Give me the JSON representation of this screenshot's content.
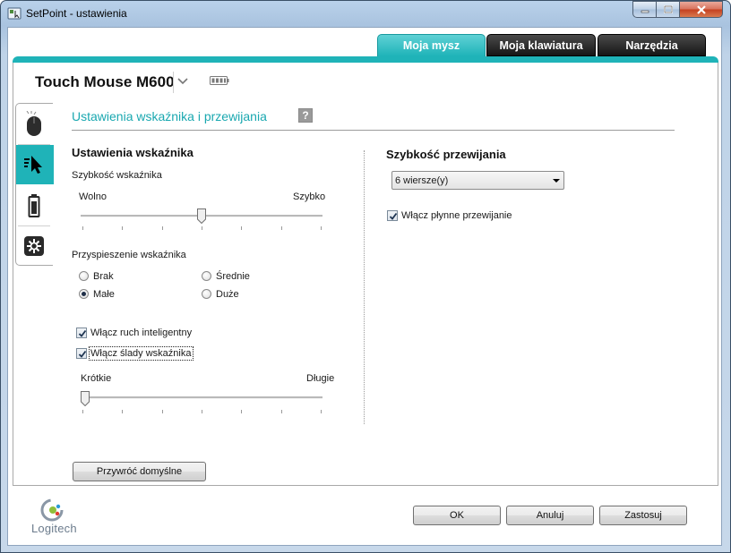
{
  "window": {
    "title": "SetPoint - ustawienia",
    "icons": [
      "setpoint-app-icon",
      "minimize-icon",
      "maximize-icon",
      "close-icon"
    ]
  },
  "tabs": [
    {
      "label": "Moja mysz",
      "active": true
    },
    {
      "label": "Moja klawiatura",
      "active": false
    },
    {
      "label": "Narzędzia",
      "active": false
    }
  ],
  "device": {
    "name": "Touch Mouse M600"
  },
  "side_tabs": [
    {
      "icon": "mouse-icon",
      "selected": false
    },
    {
      "icon": "pointer-speed-icon",
      "selected": true
    },
    {
      "icon": "battery-icon",
      "selected": false
    },
    {
      "icon": "gear-icon",
      "selected": false
    }
  ],
  "main": {
    "heading": "Ustawienia wskaźnika i przewijania",
    "help_label": "?"
  },
  "pointer": {
    "heading": "Ustawienia wskaźnika",
    "speed": {
      "label": "Szybkość wskaźnika",
      "min_label": "Wolno",
      "max_label": "Szybko",
      "value_fraction": 0.5
    },
    "acceleration": {
      "label": "Przyspieszenie wskaźnika",
      "options": [
        "Brak",
        "Średnie",
        "Małe",
        "Duże"
      ],
      "selected": "Małe"
    },
    "smart_move": {
      "label": "Włącz ruch inteligentny",
      "checked": true
    },
    "trails": {
      "label": "Włącz ślady wskaźnika",
      "checked": true
    },
    "trail_length": {
      "min_label": "Krótkie",
      "max_label": "Długie",
      "value_fraction": 0.0
    }
  },
  "scroll": {
    "heading": "Szybkość przewijania",
    "lines_value": "6  wiersze(y)",
    "smooth": {
      "label": "Włącz płynne przewijanie",
      "checked": true
    }
  },
  "buttons": {
    "restore": "Przywróć domyślne",
    "ok": "OK",
    "cancel": "Anuluj",
    "apply": "Zastosuj"
  },
  "brand": {
    "logo_text": "Logitech"
  },
  "colors": {
    "accent": "#1fb3b8",
    "tab_dark": "#1a1a1a"
  }
}
